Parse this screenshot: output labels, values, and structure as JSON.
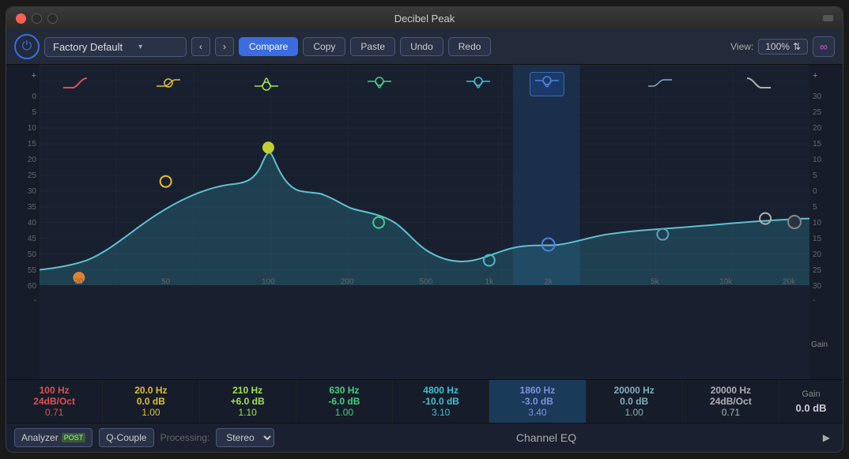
{
  "window": {
    "title": "Decibel Peak",
    "footer_title": "Channel EQ"
  },
  "toolbar": {
    "preset_name": "Factory Default",
    "compare_label": "Compare",
    "copy_label": "Copy",
    "paste_label": "Paste",
    "undo_label": "Undo",
    "redo_label": "Redo",
    "view_label": "View:",
    "view_value": "100%"
  },
  "db_labels_left": [
    "0",
    "5",
    "10",
    "15",
    "20",
    "25",
    "30",
    "35",
    "40",
    "45",
    "50",
    "55",
    "60"
  ],
  "db_labels_right": [
    "30",
    "25",
    "20",
    "15",
    "10",
    "5",
    "0",
    "5",
    "10",
    "15",
    "20",
    "25",
    "30"
  ],
  "freq_labels": [
    "20",
    "50",
    "100",
    "200",
    "500",
    "1k",
    "2k",
    "5k",
    "10k",
    "20k"
  ],
  "bands": [
    {
      "freq": "100 Hz",
      "gain": "24dB/Oct",
      "q": "0.71",
      "color": "#e05050",
      "type": "highpass"
    },
    {
      "freq": "20.0 Hz",
      "gain": "0.0 dB",
      "q": "1.00",
      "color": "#e0c030",
      "type": "lowshelf"
    },
    {
      "freq": "210 Hz",
      "gain": "+6.0 dB",
      "q": "1.10",
      "color": "#a0e050",
      "type": "bell"
    },
    {
      "freq": "630 Hz",
      "gain": "-6.0 dB",
      "q": "1.00",
      "color": "#40d080",
      "type": "bell"
    },
    {
      "freq": "4800 Hz",
      "gain": "-10.0 dB",
      "q": "3.10",
      "color": "#40c0d0",
      "type": "bell"
    },
    {
      "freq": "1860 Hz",
      "gain": "-3.0 dB",
      "q": "3.40",
      "color": "#5080e0",
      "type": "bell",
      "active": true
    },
    {
      "freq": "20000 Hz",
      "gain": "0.0 dB",
      "q": "1.00",
      "color": "#60a0c0",
      "type": "highshelf"
    },
    {
      "freq": "20000 Hz",
      "gain": "24dB/Oct",
      "q": "0.71",
      "color": "#c0c0c0",
      "type": "lowpass"
    }
  ],
  "gain_value": "0.0 dB",
  "bottom": {
    "analyzer_label": "Analyzer",
    "post_label": "POST",
    "qcouple_label": "Q-Couple",
    "processing_label": "Processing:",
    "processing_value": "Stereo"
  }
}
